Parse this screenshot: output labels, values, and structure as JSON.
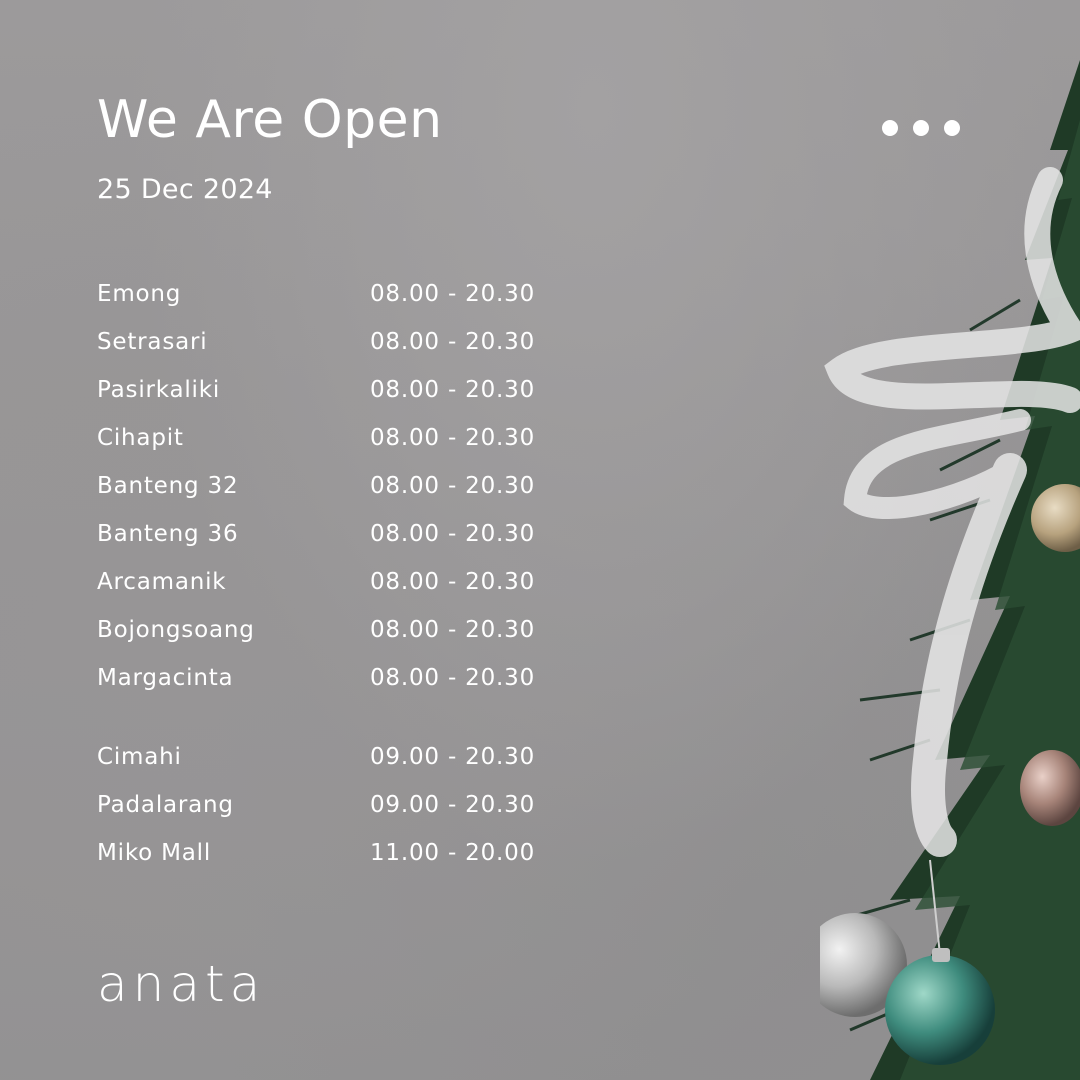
{
  "header": {
    "title": "We Are Open",
    "date": "25 Dec 2024"
  },
  "menu_icon": "more-horizontal-icon",
  "schedule": {
    "group1": [
      {
        "name": "Emong",
        "hours": "08.00 - 20.30"
      },
      {
        "name": "Setrasari",
        "hours": "08.00 - 20.30"
      },
      {
        "name": "Pasirkaliki",
        "hours": "08.00 - 20.30"
      },
      {
        "name": "Cihapit",
        "hours": "08.00 - 20.30"
      },
      {
        "name": "Banteng 32",
        "hours": "08.00 - 20.30"
      },
      {
        "name": "Banteng 36",
        "hours": "08.00 - 20.30"
      },
      {
        "name": "Arcamanik",
        "hours": "08.00 - 20.30"
      },
      {
        "name": "Bojongsoang",
        "hours": "08.00 - 20.30"
      },
      {
        "name": "Margacinta",
        "hours": "08.00 - 20.30"
      }
    ],
    "group2": [
      {
        "name": "Cimahi",
        "hours": "09.00 - 20.30"
      },
      {
        "name": "Padalarang",
        "hours": "09.00 - 20.30"
      },
      {
        "name": "Miko Mall",
        "hours": "11.00 - 20.00"
      }
    ]
  },
  "brand": {
    "logo_text": "anata"
  },
  "colors": {
    "text": "#ffffff",
    "background": "#989697",
    "tree_green": "#1f3a26"
  }
}
